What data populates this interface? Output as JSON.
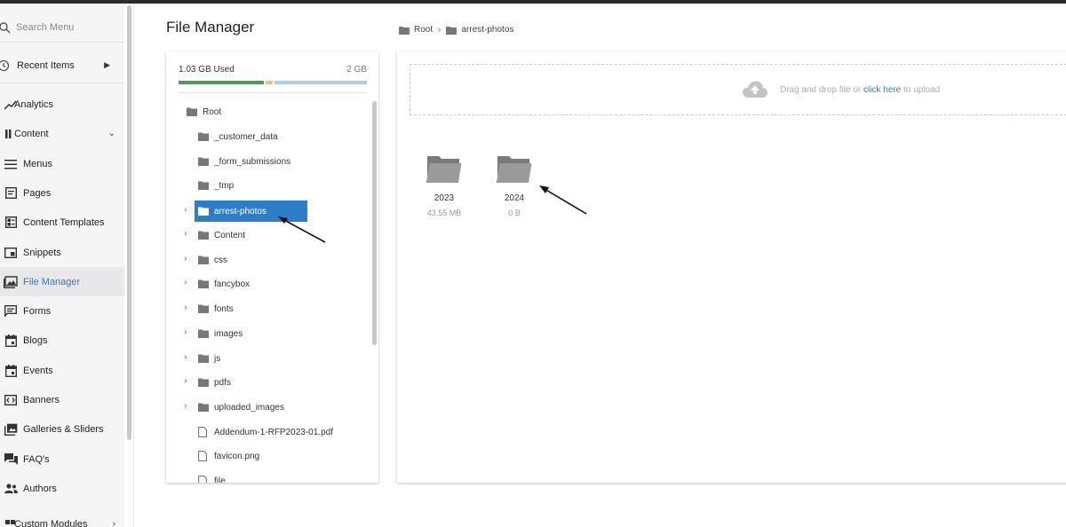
{
  "sidebar": {
    "search_placeholder": "Search Menu",
    "recent_items": "Recent Items",
    "items": [
      {
        "label": "Analytics",
        "icon": "trend-icon"
      },
      {
        "label": "Content",
        "icon": "content-icon"
      },
      {
        "label": "Menus",
        "icon": "menu-icon"
      },
      {
        "label": "Pages",
        "icon": "page-icon"
      },
      {
        "label": "Content Templates",
        "icon": "template-icon"
      },
      {
        "label": "Snippets",
        "icon": "snippet-icon"
      },
      {
        "label": "File Manager",
        "icon": "image-folder-icon",
        "active": true
      },
      {
        "label": "Forms",
        "icon": "forms-icon"
      },
      {
        "label": "Blogs",
        "icon": "calendar-icon"
      },
      {
        "label": "Events",
        "icon": "calendar-icon"
      },
      {
        "label": "Banners",
        "icon": "banner-icon"
      },
      {
        "label": "Galleries & Sliders",
        "icon": "gallery-icon"
      },
      {
        "label": "FAQ's",
        "icon": "faq-icon"
      },
      {
        "label": "Authors",
        "icon": "authors-icon"
      },
      {
        "label": "Custom Modules",
        "icon": "modules-icon"
      }
    ]
  },
  "header": {
    "title": "File Manager",
    "breadcrumb": [
      "Root",
      "arrest-photos"
    ]
  },
  "storage": {
    "used": "1.03 GB Used",
    "total": "2 GB"
  },
  "tree": [
    {
      "label": "Root",
      "type": "folder"
    },
    {
      "label": "_customer_data",
      "type": "folder"
    },
    {
      "label": "_form_submissions",
      "type": "folder"
    },
    {
      "label": "_tmp",
      "type": "folder"
    },
    {
      "label": "arrest-photos",
      "type": "folder",
      "selected": true
    },
    {
      "label": "Content",
      "type": "folder"
    },
    {
      "label": "css",
      "type": "folder"
    },
    {
      "label": "fancybox",
      "type": "folder"
    },
    {
      "label": "fonts",
      "type": "folder"
    },
    {
      "label": "images",
      "type": "folder"
    },
    {
      "label": "js",
      "type": "folder"
    },
    {
      "label": "pdfs",
      "type": "folder"
    },
    {
      "label": "uploaded_images",
      "type": "folder"
    },
    {
      "label": "Addendum-1-RFP2023-01.pdf",
      "type": "file"
    },
    {
      "label": "favicon.png",
      "type": "file"
    },
    {
      "label": "file",
      "type": "file"
    }
  ],
  "dropzone": {
    "text_before": "Drag and drop file or",
    "link": "click here",
    "text_after": "to upload"
  },
  "folders": [
    {
      "name": "2023",
      "size": "43.55 MB"
    },
    {
      "name": "2024",
      "size": "0 B"
    }
  ],
  "colors": {
    "accent": "#2d7ec9",
    "link": "#3a78b7",
    "usage_used": "#4a9a5a",
    "usage_mid": "#f3c27a",
    "usage_free": "#a9cdee",
    "folder": "#8a8a8a"
  }
}
